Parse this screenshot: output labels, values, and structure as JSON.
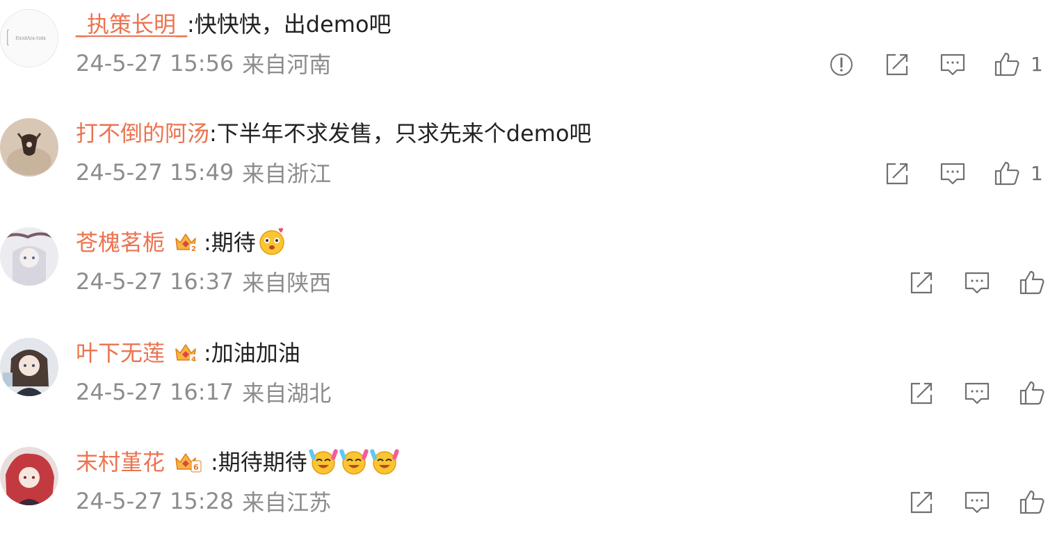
{
  "comments": [
    {
      "username": "_执策长明_",
      "text": ":快快快，出demo吧",
      "timestamp": "24-5-27 15:56",
      "location": "来自河南",
      "like_count": "1",
      "has_report": true,
      "badge": null,
      "emoji_count": 0
    },
    {
      "username": "打不倒的阿汤",
      "text": ":下半年不求发售，只求先来个demo吧",
      "timestamp": "24-5-27 15:49",
      "location": "来自浙江",
      "like_count": "1",
      "has_report": false,
      "badge": null,
      "emoji_count": 0
    },
    {
      "username": "苍槐茗栀",
      "text": ":期待",
      "timestamp": "24-5-27 16:37",
      "location": "来自陕西",
      "like_count": "",
      "has_report": false,
      "badge": "crown-badge-level-2",
      "emoji_count": 1,
      "emoji": "heart-eyes-emoji"
    },
    {
      "username": "叶下无莲",
      "text": ":加油加油",
      "timestamp": "24-5-27 16:17",
      "location": "来自湖北",
      "like_count": "",
      "has_report": false,
      "badge": "crown-badge-level-4",
      "emoji_count": 0
    },
    {
      "username": "末村堇花",
      "text": ":期待期待",
      "timestamp": "24-5-27 15:28",
      "location": "来自江苏",
      "like_count": "",
      "has_report": false,
      "badge": "crown-badge-level-6",
      "emoji_count": 3,
      "emoji": "crying-laughing-glowsticks-emoji"
    }
  ],
  "colors": {
    "username": "#eb7350",
    "text": "#222222",
    "meta": "#8c8c8c",
    "icon": "#6f6f6f"
  },
  "icons": {
    "report": "report-icon",
    "share": "share-icon",
    "reply": "comment-icon",
    "like": "like-icon"
  }
}
